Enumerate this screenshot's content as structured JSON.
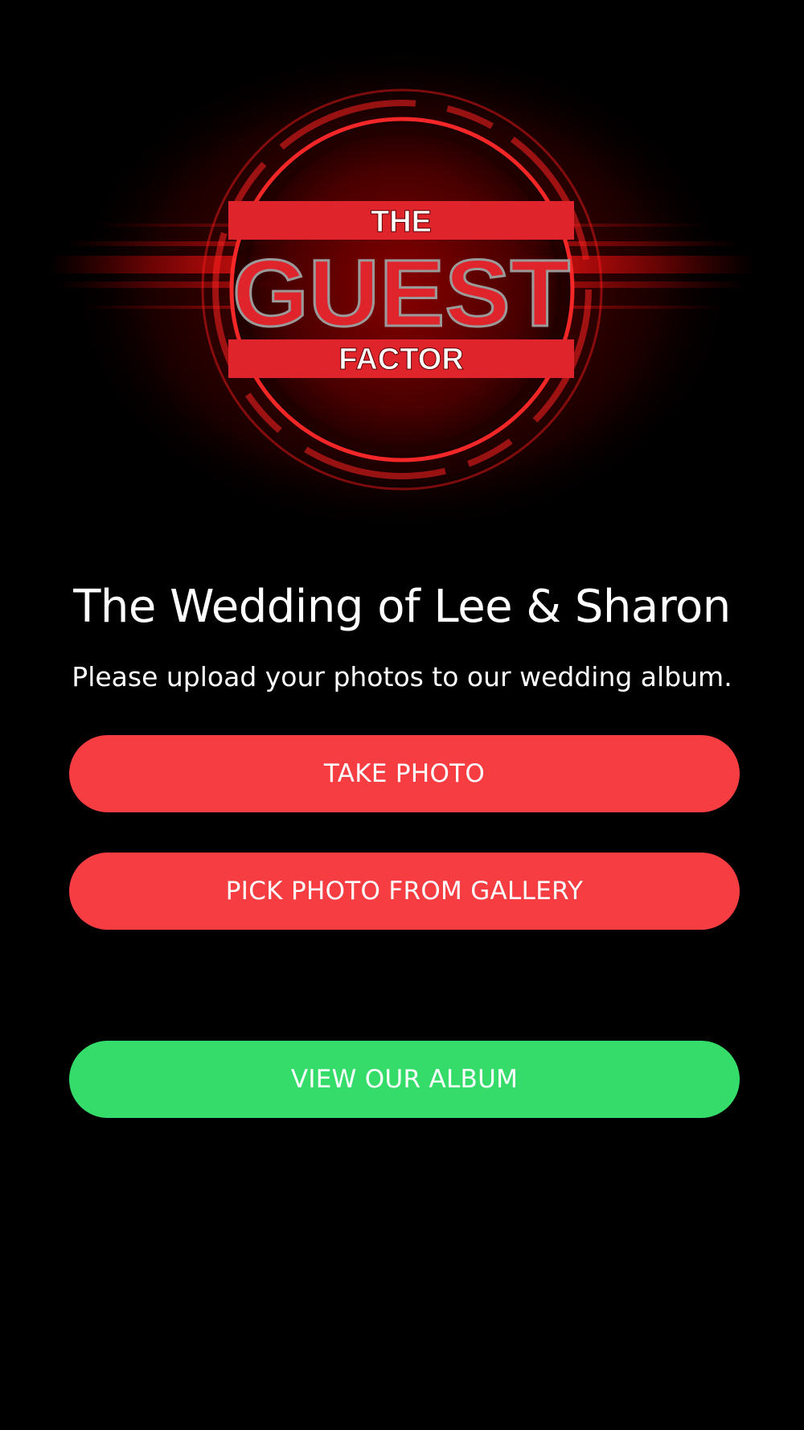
{
  "logo": {
    "line1": "THE",
    "line2": "GUEST",
    "line3": "FACTOR"
  },
  "main": {
    "title": "The Wedding of Lee & Sharon",
    "subtitle": "Please upload your photos to our wedding album."
  },
  "buttons": {
    "take_photo": "TAKE PHOTO",
    "pick_photo": "PICK PHOTO FROM GALLERY",
    "view_album": "VIEW OUR ALBUM"
  },
  "colors": {
    "background": "#000000",
    "primary_button": "#f53d42",
    "album_button": "#35dc69",
    "logo_red": "#e0242c"
  }
}
